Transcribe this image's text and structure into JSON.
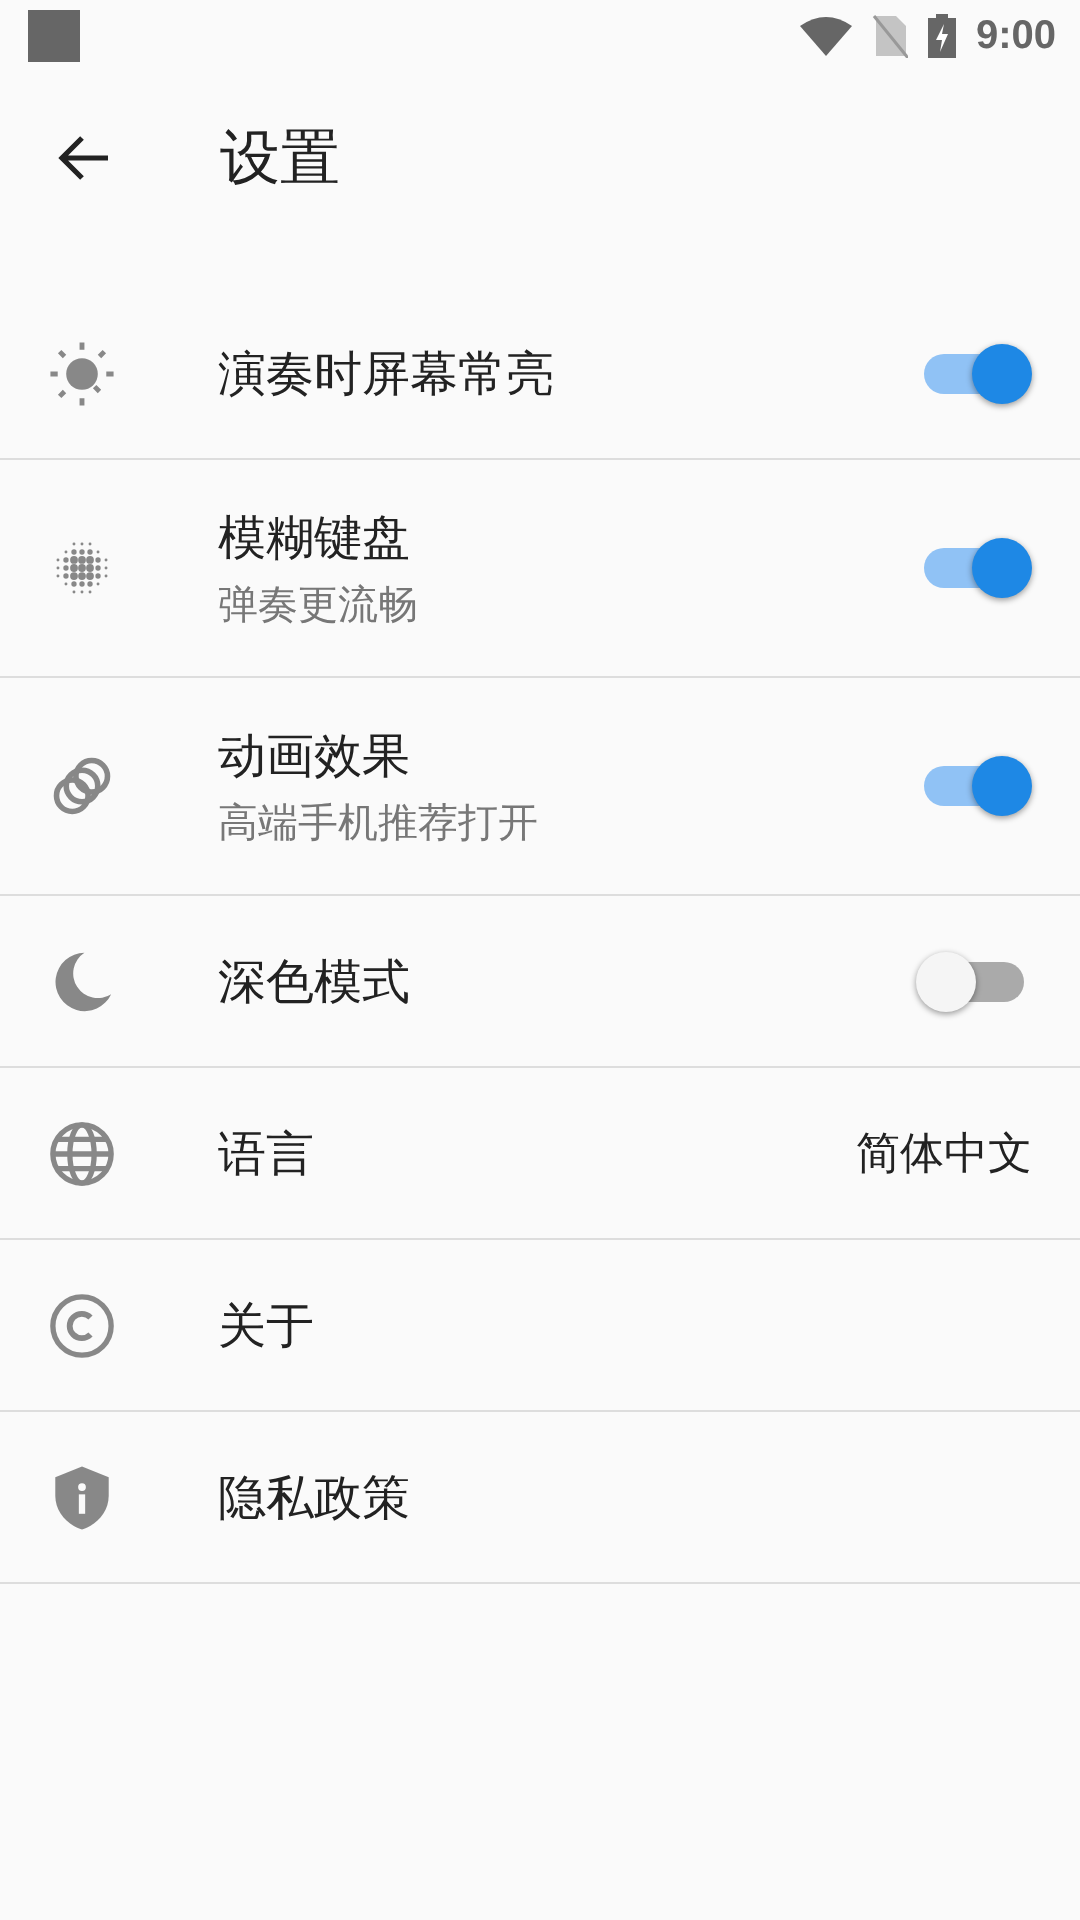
{
  "status_bar": {
    "time": "9:00"
  },
  "app_bar": {
    "title": "设置"
  },
  "settings": [
    {
      "kind": "toggle",
      "title": "演奏时屏幕常亮",
      "on": true
    },
    {
      "kind": "toggle",
      "title": "模糊键盘",
      "subtitle": "弹奏更流畅",
      "on": true
    },
    {
      "kind": "toggle",
      "title": "动画效果",
      "subtitle": "高端手机推荐打开",
      "on": true
    },
    {
      "kind": "toggle",
      "title": "深色模式",
      "on": false
    },
    {
      "kind": "value",
      "title": "语言",
      "value": "简体中文"
    },
    {
      "kind": "link",
      "title": "关于"
    },
    {
      "kind": "link",
      "title": "隐私政策"
    }
  ]
}
